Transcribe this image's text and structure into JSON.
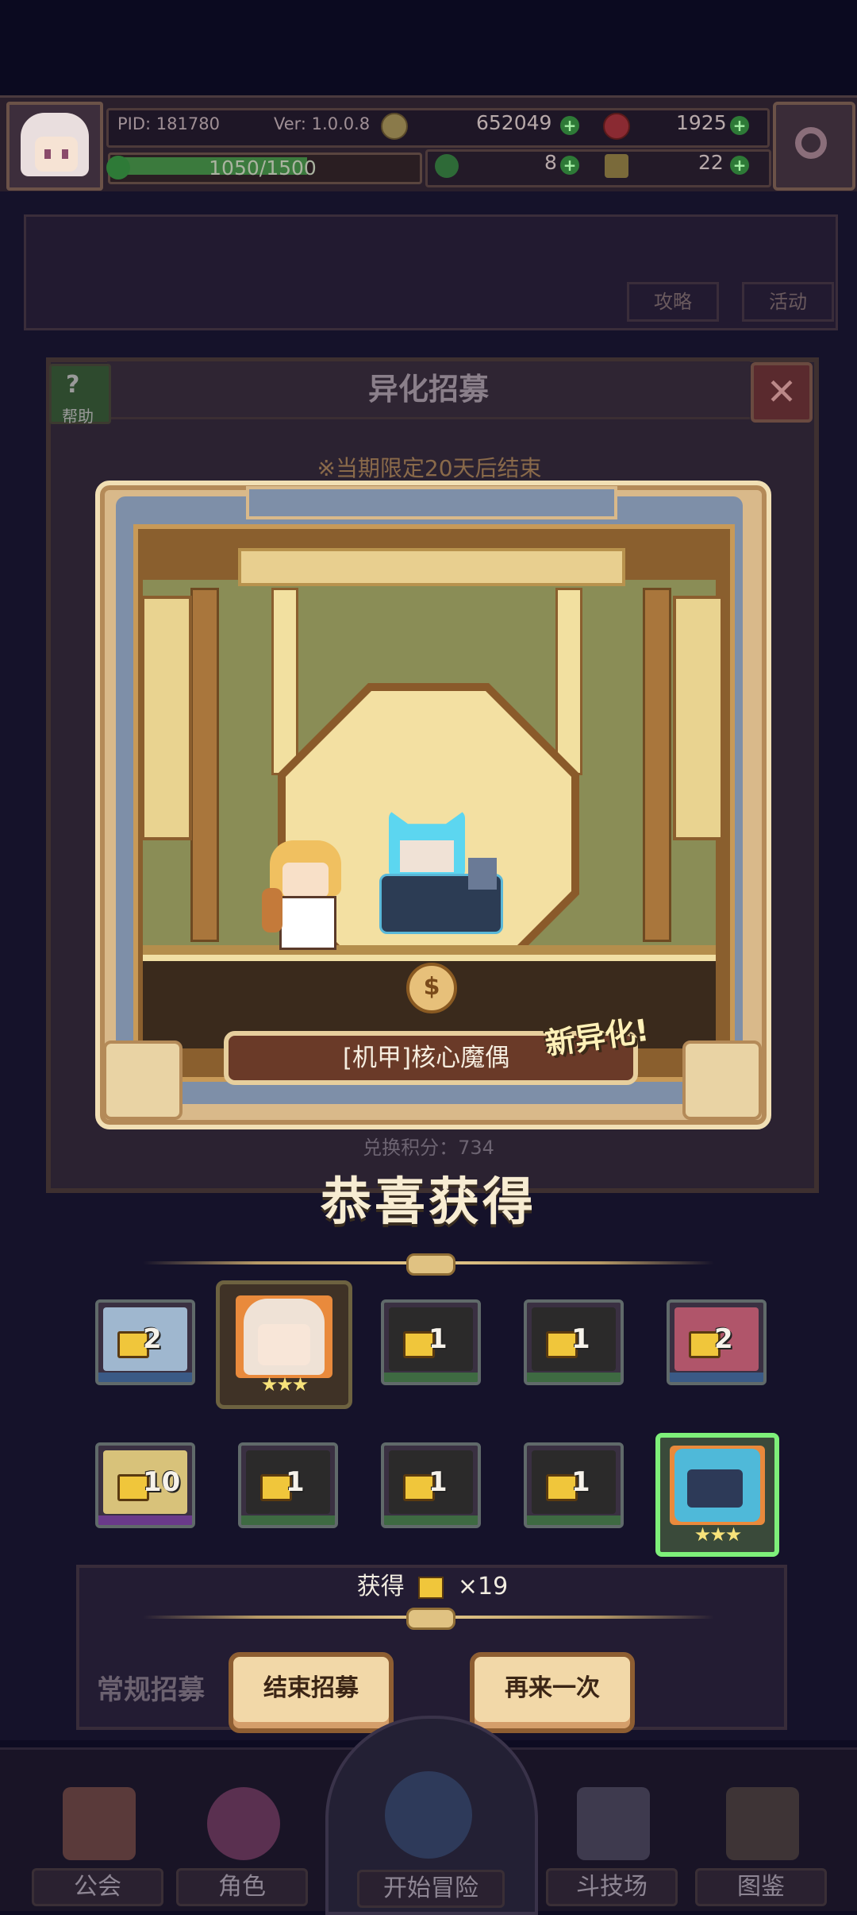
{
  "header": {
    "pid": "PID: 181780",
    "version": "Ver: 1.0.0.8",
    "gold": "652049",
    "gems": "1925",
    "xp": "1050/1500",
    "clover": "8",
    "key": "22"
  },
  "background": {
    "tabs": [
      "攻略",
      "活动"
    ]
  },
  "recruit": {
    "title": "异化招募",
    "help": "帮助",
    "limit_notice": "※当期限定20天后结束",
    "points_text": "兑换积分：734"
  },
  "reveal": {
    "character_name": "[机甲]核心魔偶",
    "new_badge": "新异化!",
    "congrats": "恭喜获得"
  },
  "results": {
    "row1": [
      {
        "count": "2",
        "color": "#9fb7cf",
        "bottom": "#3a5a86"
      },
      {
        "stars": "★★★",
        "color": "#efe2d6",
        "bottom": "#c07a3a",
        "highlight": true
      },
      {
        "count": "1",
        "color": "#2b2a2a",
        "bottom": "#3e6a42"
      },
      {
        "count": "1",
        "color": "#2b2a2a",
        "bottom": "#3e6a42"
      },
      {
        "count": "2",
        "color": "#b0556a",
        "bottom": "#3a5a86"
      }
    ],
    "row2": [
      {
        "count": "10",
        "color": "#d8c27a",
        "bottom": "#6a3a8a"
      },
      {
        "count": "1",
        "color": "#2b2a2a",
        "bottom": "#3e6a42"
      },
      {
        "count": "1",
        "color": "#2b2a2a",
        "bottom": "#3e6a42"
      },
      {
        "count": "1",
        "color": "#2b2a2a",
        "bottom": "#3e6a42"
      },
      {
        "stars": "★★★",
        "color": "#4fb9d9",
        "bottom": "#c07a3a",
        "selected": true
      }
    ],
    "obtain_label": "获得",
    "obtain_count": "×19"
  },
  "buttons": {
    "end_recruit": "结束招募",
    "again": "再来一次"
  },
  "dim_labels": {
    "normal_recruit": "常规招募"
  },
  "nav": [
    {
      "label": "公会",
      "icon": "guild-icon"
    },
    {
      "label": "角色",
      "icon": "character-icon"
    },
    {
      "label": "开始冒险",
      "icon": "adventure-icon"
    },
    {
      "label": "斗技场",
      "icon": "arena-icon"
    },
    {
      "label": "图鉴",
      "icon": "codex-icon"
    }
  ]
}
